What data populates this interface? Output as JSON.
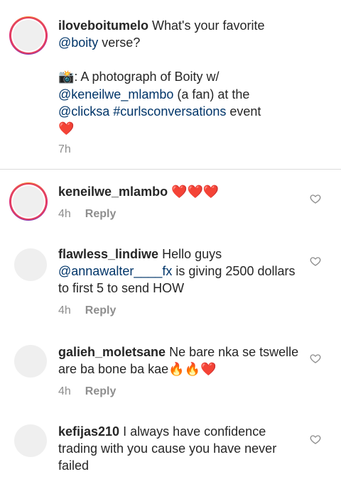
{
  "caption": {
    "username": "iloveboitumelo",
    "line1_text": " What's your favorite",
    "mention1": "@boity",
    "line2_rest": " verse?",
    "camera_emoji": "📸",
    "photo_text": ": A photograph of Boity w/",
    "mention2": "@keneilwe_mlambo",
    "fan_text": " (a fan) at the",
    "mention3": "@clicksa",
    "hashtag": "#curlsconversations",
    "event_text": " event",
    "heart_emoji": "❤️",
    "time": "7h"
  },
  "comments": [
    {
      "username": "keneilwe_mlambo",
      "text": "❤️❤️❤️",
      "time": "4h",
      "reply_label": "Reply"
    },
    {
      "username": "flawless_lindiwe",
      "text_a": " Hello guys",
      "mention": "@annawalter____fx",
      "text_b": " is giving 2500 dollars to first 5 to send HOW",
      "time": "4h",
      "reply_label": "Reply"
    },
    {
      "username": "galieh_moletsane",
      "text": " Ne bare nka se tswelle are ba bone ba kae",
      "emojis": "🔥🔥❤️",
      "time": "4h",
      "reply_label": "Reply"
    },
    {
      "username": "kefijas210",
      "text": " I always have confidence trading with you cause you have never failed"
    }
  ],
  "icons": {
    "like": "heart-outline-icon"
  },
  "colors": {
    "link": "#003569",
    "meta": "#8e8e8e",
    "story_ring": "#e4405f",
    "divider": "#dbdbdb"
  }
}
